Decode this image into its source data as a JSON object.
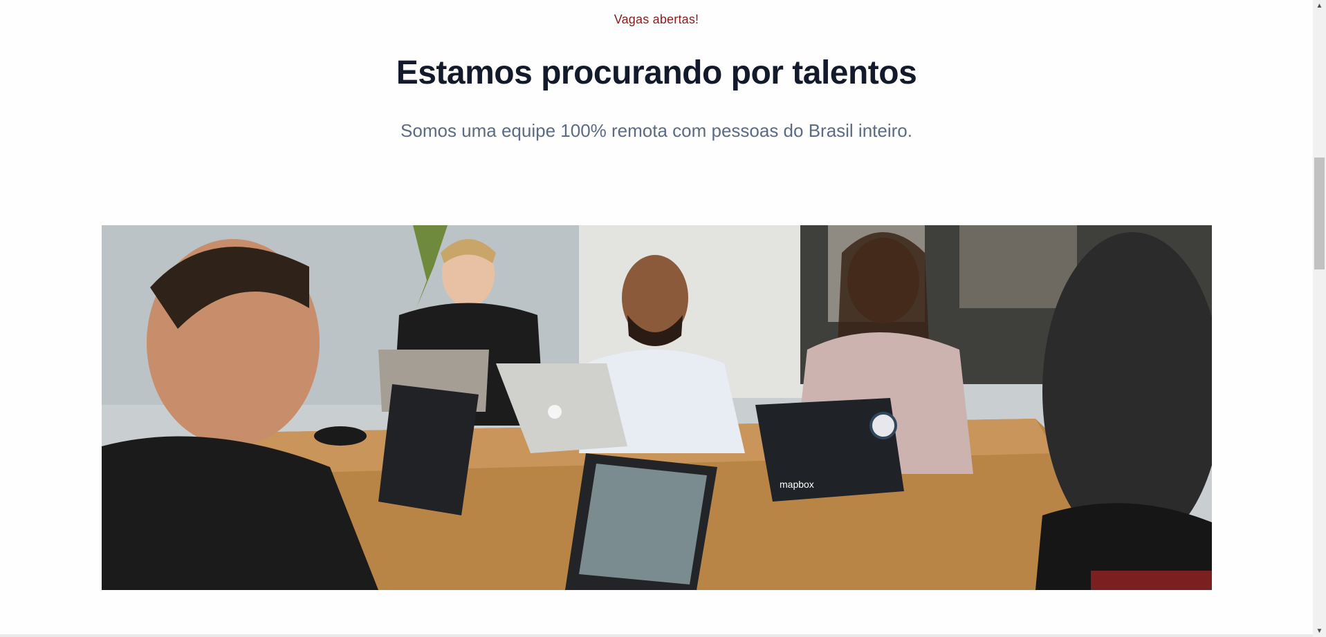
{
  "section": {
    "eyebrow": "Vagas abertas!",
    "headline": "Estamos procurando por talentos",
    "subhead": "Somos uma equipe 100% remota com pessoas do Brasil inteiro."
  },
  "photo": {
    "description_icon": "team-photo",
    "laptop_sticker_text": "mapbox"
  },
  "colors": {
    "eyebrow": "#8b1a1a",
    "headline": "#121a2b",
    "subhead": "#5b6b83"
  }
}
